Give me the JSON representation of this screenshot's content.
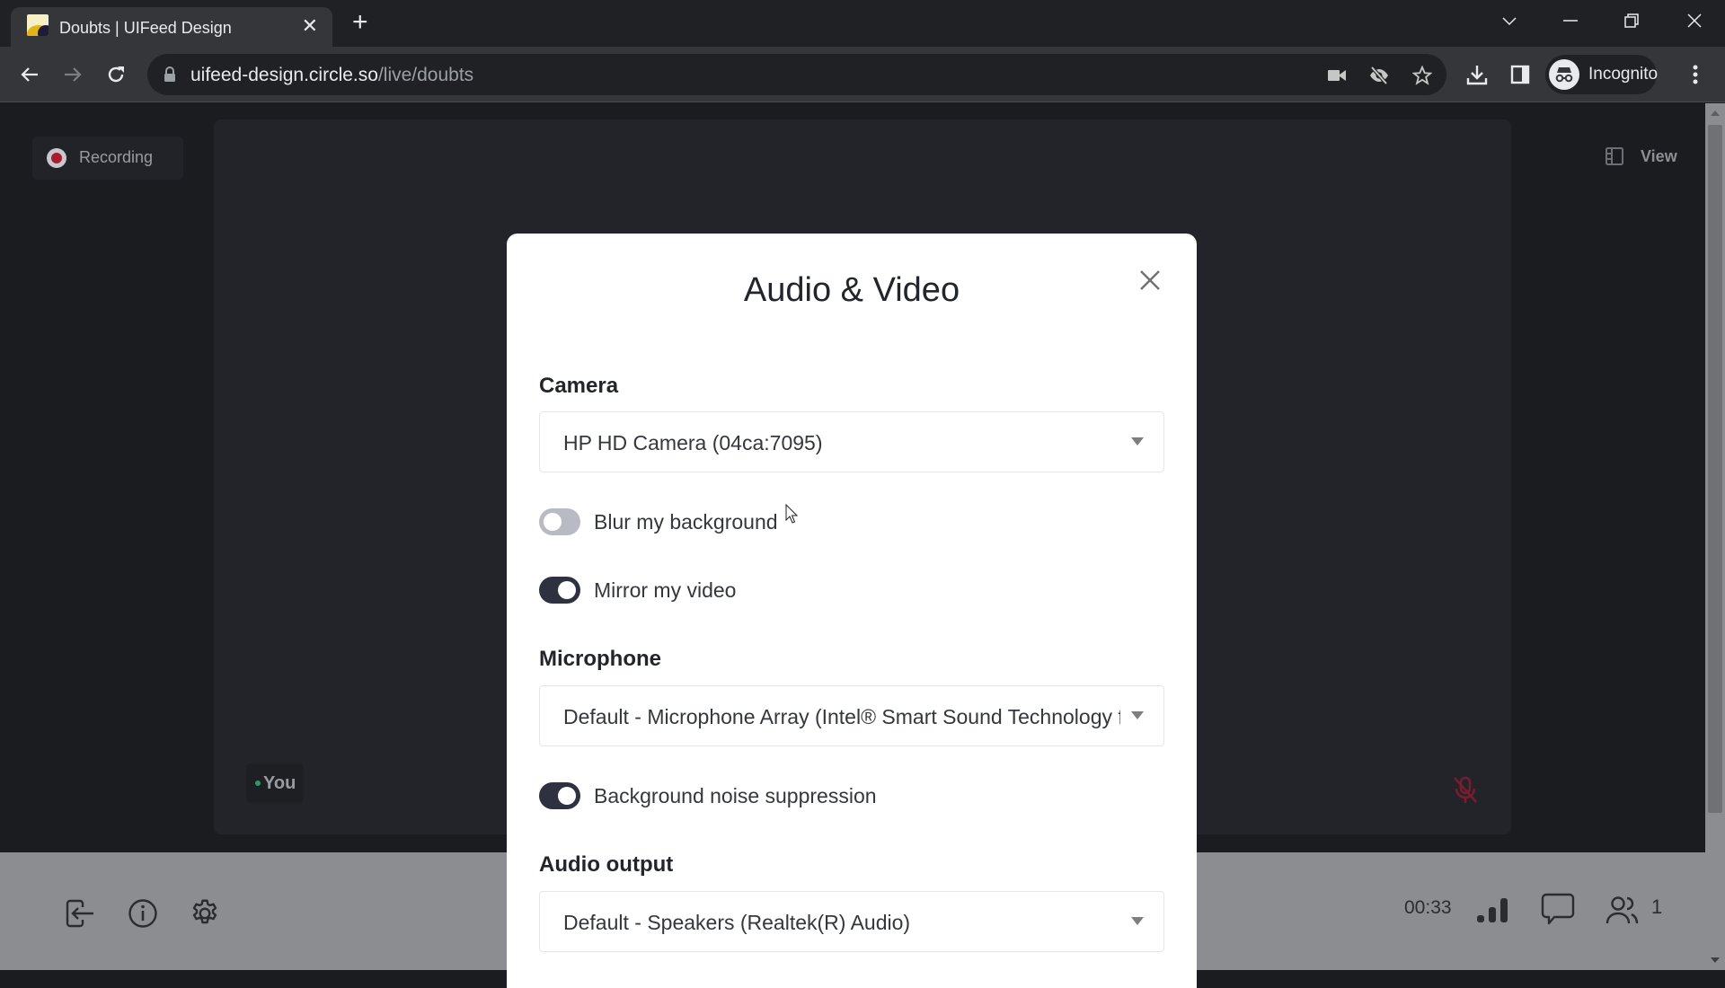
{
  "browser": {
    "tab": {
      "title": "Doubts | UIFeed Design",
      "favicon": "business-favicon",
      "close": "✕"
    },
    "new_tab": "+",
    "url": {
      "host": "uifeed-design.circle.so",
      "path": "/live/doubts"
    },
    "profile_label": "Incognito",
    "window_controls": [
      "tab-search",
      "minimize",
      "restore",
      "close"
    ]
  },
  "room": {
    "recording_label": "Recording",
    "view_label": "View",
    "participant_tag": "You",
    "participant_muted": true,
    "timer": "00:33",
    "participant_count": "1",
    "colors": {
      "recording": "#a61b35",
      "online_dot": "#2e9a6b",
      "muted": "#a61b35"
    }
  },
  "modal": {
    "title": "Audio & Video",
    "camera": {
      "label": "Camera",
      "selected": "HP HD Camera (04ca:7095)"
    },
    "blur_background": {
      "label": "Blur my background",
      "enabled": false
    },
    "mirror_video": {
      "label": "Mirror my video",
      "enabled": true
    },
    "microphone": {
      "label": "Microphone",
      "selected": "Default - Microphone Array (Intel® Smart Sound Technology for Digital Microphones)"
    },
    "noise_suppression": {
      "label": "Background noise suppression",
      "enabled": true
    },
    "audio_output": {
      "label": "Audio output",
      "selected": "Default - Speakers (Realtek(R) Audio)"
    }
  }
}
